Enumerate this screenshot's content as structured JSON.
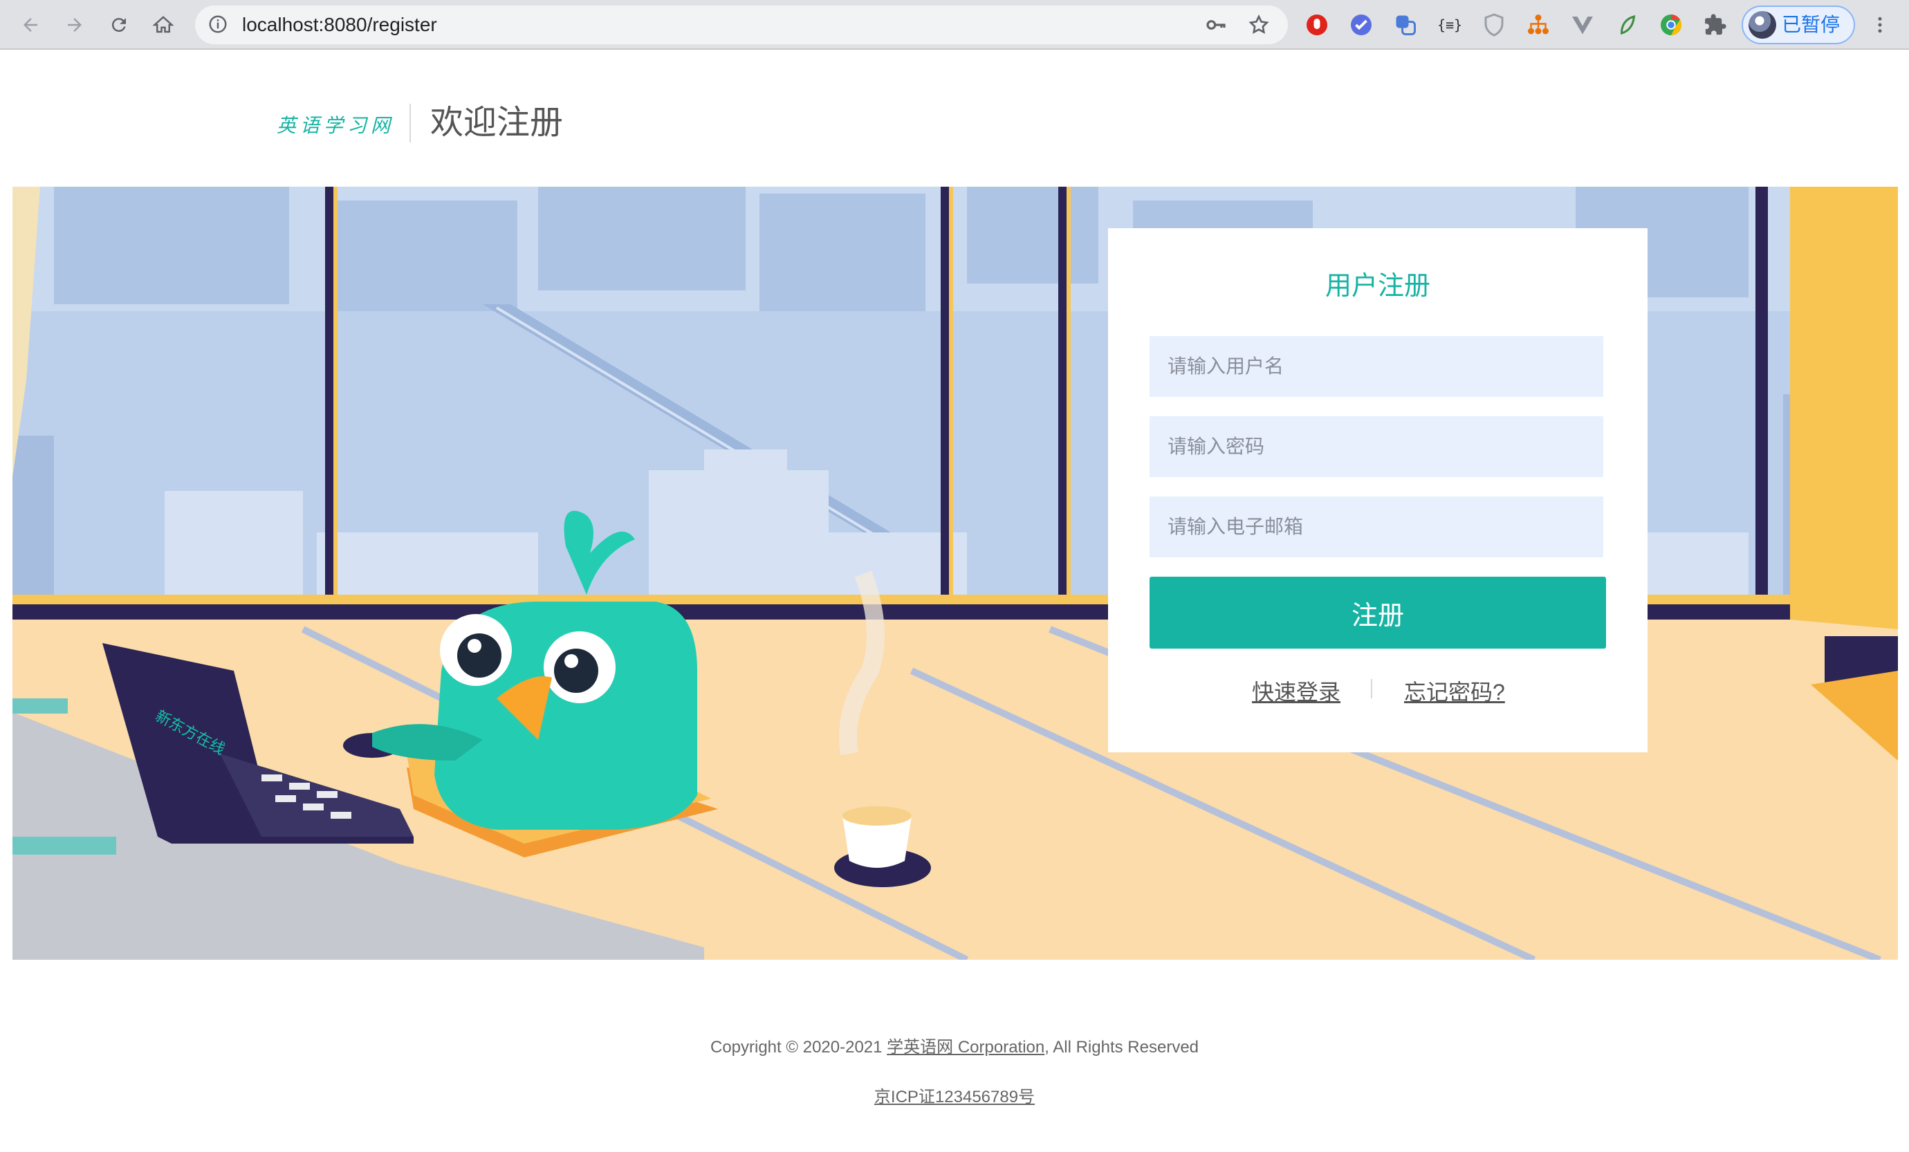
{
  "browser": {
    "url": "localhost:8080/register",
    "profile_label": "已暂停"
  },
  "header": {
    "logo_text": "英语学习网",
    "title": "欢迎注册"
  },
  "register_form": {
    "title": "用户注册",
    "username_placeholder": "请输入用户名",
    "password_placeholder": "请输入密码",
    "email_placeholder": "请输入电子邮箱",
    "submit_label": "注册",
    "quick_login_label": "快速登录",
    "forgot_password_label": "忘记密码?"
  },
  "hero": {
    "laptop_logo_text": "新东方在线"
  },
  "footer": {
    "copyright_prefix": "Copyright © 2020-2021 ",
    "company_link": "学英语网 Corporation",
    "copyright_suffix": ", All Rights Reserved",
    "icp_link": "京ICP证123456789号"
  },
  "colors": {
    "accent": "#17b3a3",
    "input_bg": "#e8f0fe",
    "chrome_bg": "#dfe1e5"
  }
}
